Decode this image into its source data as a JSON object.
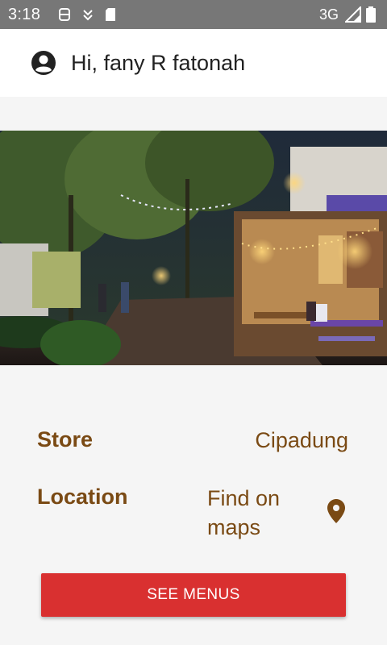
{
  "status_bar": {
    "time": "3:18",
    "network": "3G",
    "icons": [
      "android-debug-icon",
      "download-icon",
      "sd-card-icon",
      "signal-icon",
      "battery-icon"
    ]
  },
  "header": {
    "greeting": "Hi, fany R fatonah",
    "avatar_icon": "account-circle-icon"
  },
  "hero": {
    "image_subject": "store-photo"
  },
  "store_info": {
    "store_label": "Store",
    "store_value": "Cipadung",
    "location_label": "Location",
    "location_value": "Find on maps",
    "location_icon": "map-pin-icon"
  },
  "actions": {
    "see_menus": "SEE MENUS"
  },
  "colors": {
    "status_bar": "#777777",
    "label_brown": "#7a4a14",
    "button_red": "#d93030",
    "background": "#f5f5f5"
  }
}
